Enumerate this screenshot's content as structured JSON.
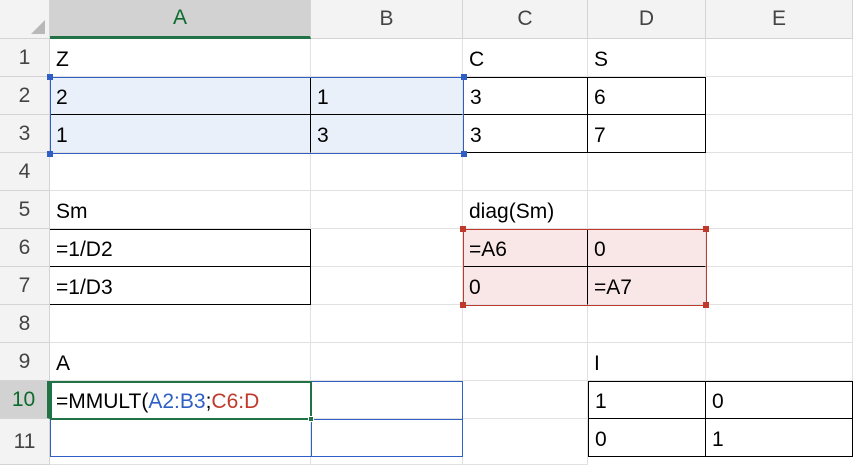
{
  "columns": [
    "A",
    "B",
    "C",
    "D",
    "E"
  ],
  "rows": [
    "1",
    "2",
    "3",
    "4",
    "5",
    "6",
    "7",
    "8",
    "9",
    "10",
    "11"
  ],
  "cells": {
    "A1": "Z",
    "C1": "C",
    "D1": "S",
    "A2": "2",
    "B2": "1",
    "C2": "3",
    "D2": "6",
    "A3": "1",
    "B3": "3",
    "C3": "3",
    "D3": "7",
    "A5": "Sm",
    "C5": "diag(Sm)",
    "A6": "=1/D2",
    "C6": "=A6",
    "D6": "0",
    "A7": "=1/D3",
    "C7": "0",
    "D7": "=A7",
    "A9": "A",
    "D9": "I",
    "D10": "1",
    "E10": "0",
    "D11": "0",
    "E11": "1"
  },
  "editing_formula": {
    "cell": "A10",
    "prefix": "=MMULT(",
    "ref1": "A2:B3",
    "sep": ";",
    "ref2": "C6:D"
  },
  "colors": {
    "selection_green": "#217346",
    "ref_blue": "#2f5fc4",
    "ref_red": "#c0392b",
    "blue_fill": "#eaf0f9",
    "red_fill": "#f9e6e7"
  }
}
